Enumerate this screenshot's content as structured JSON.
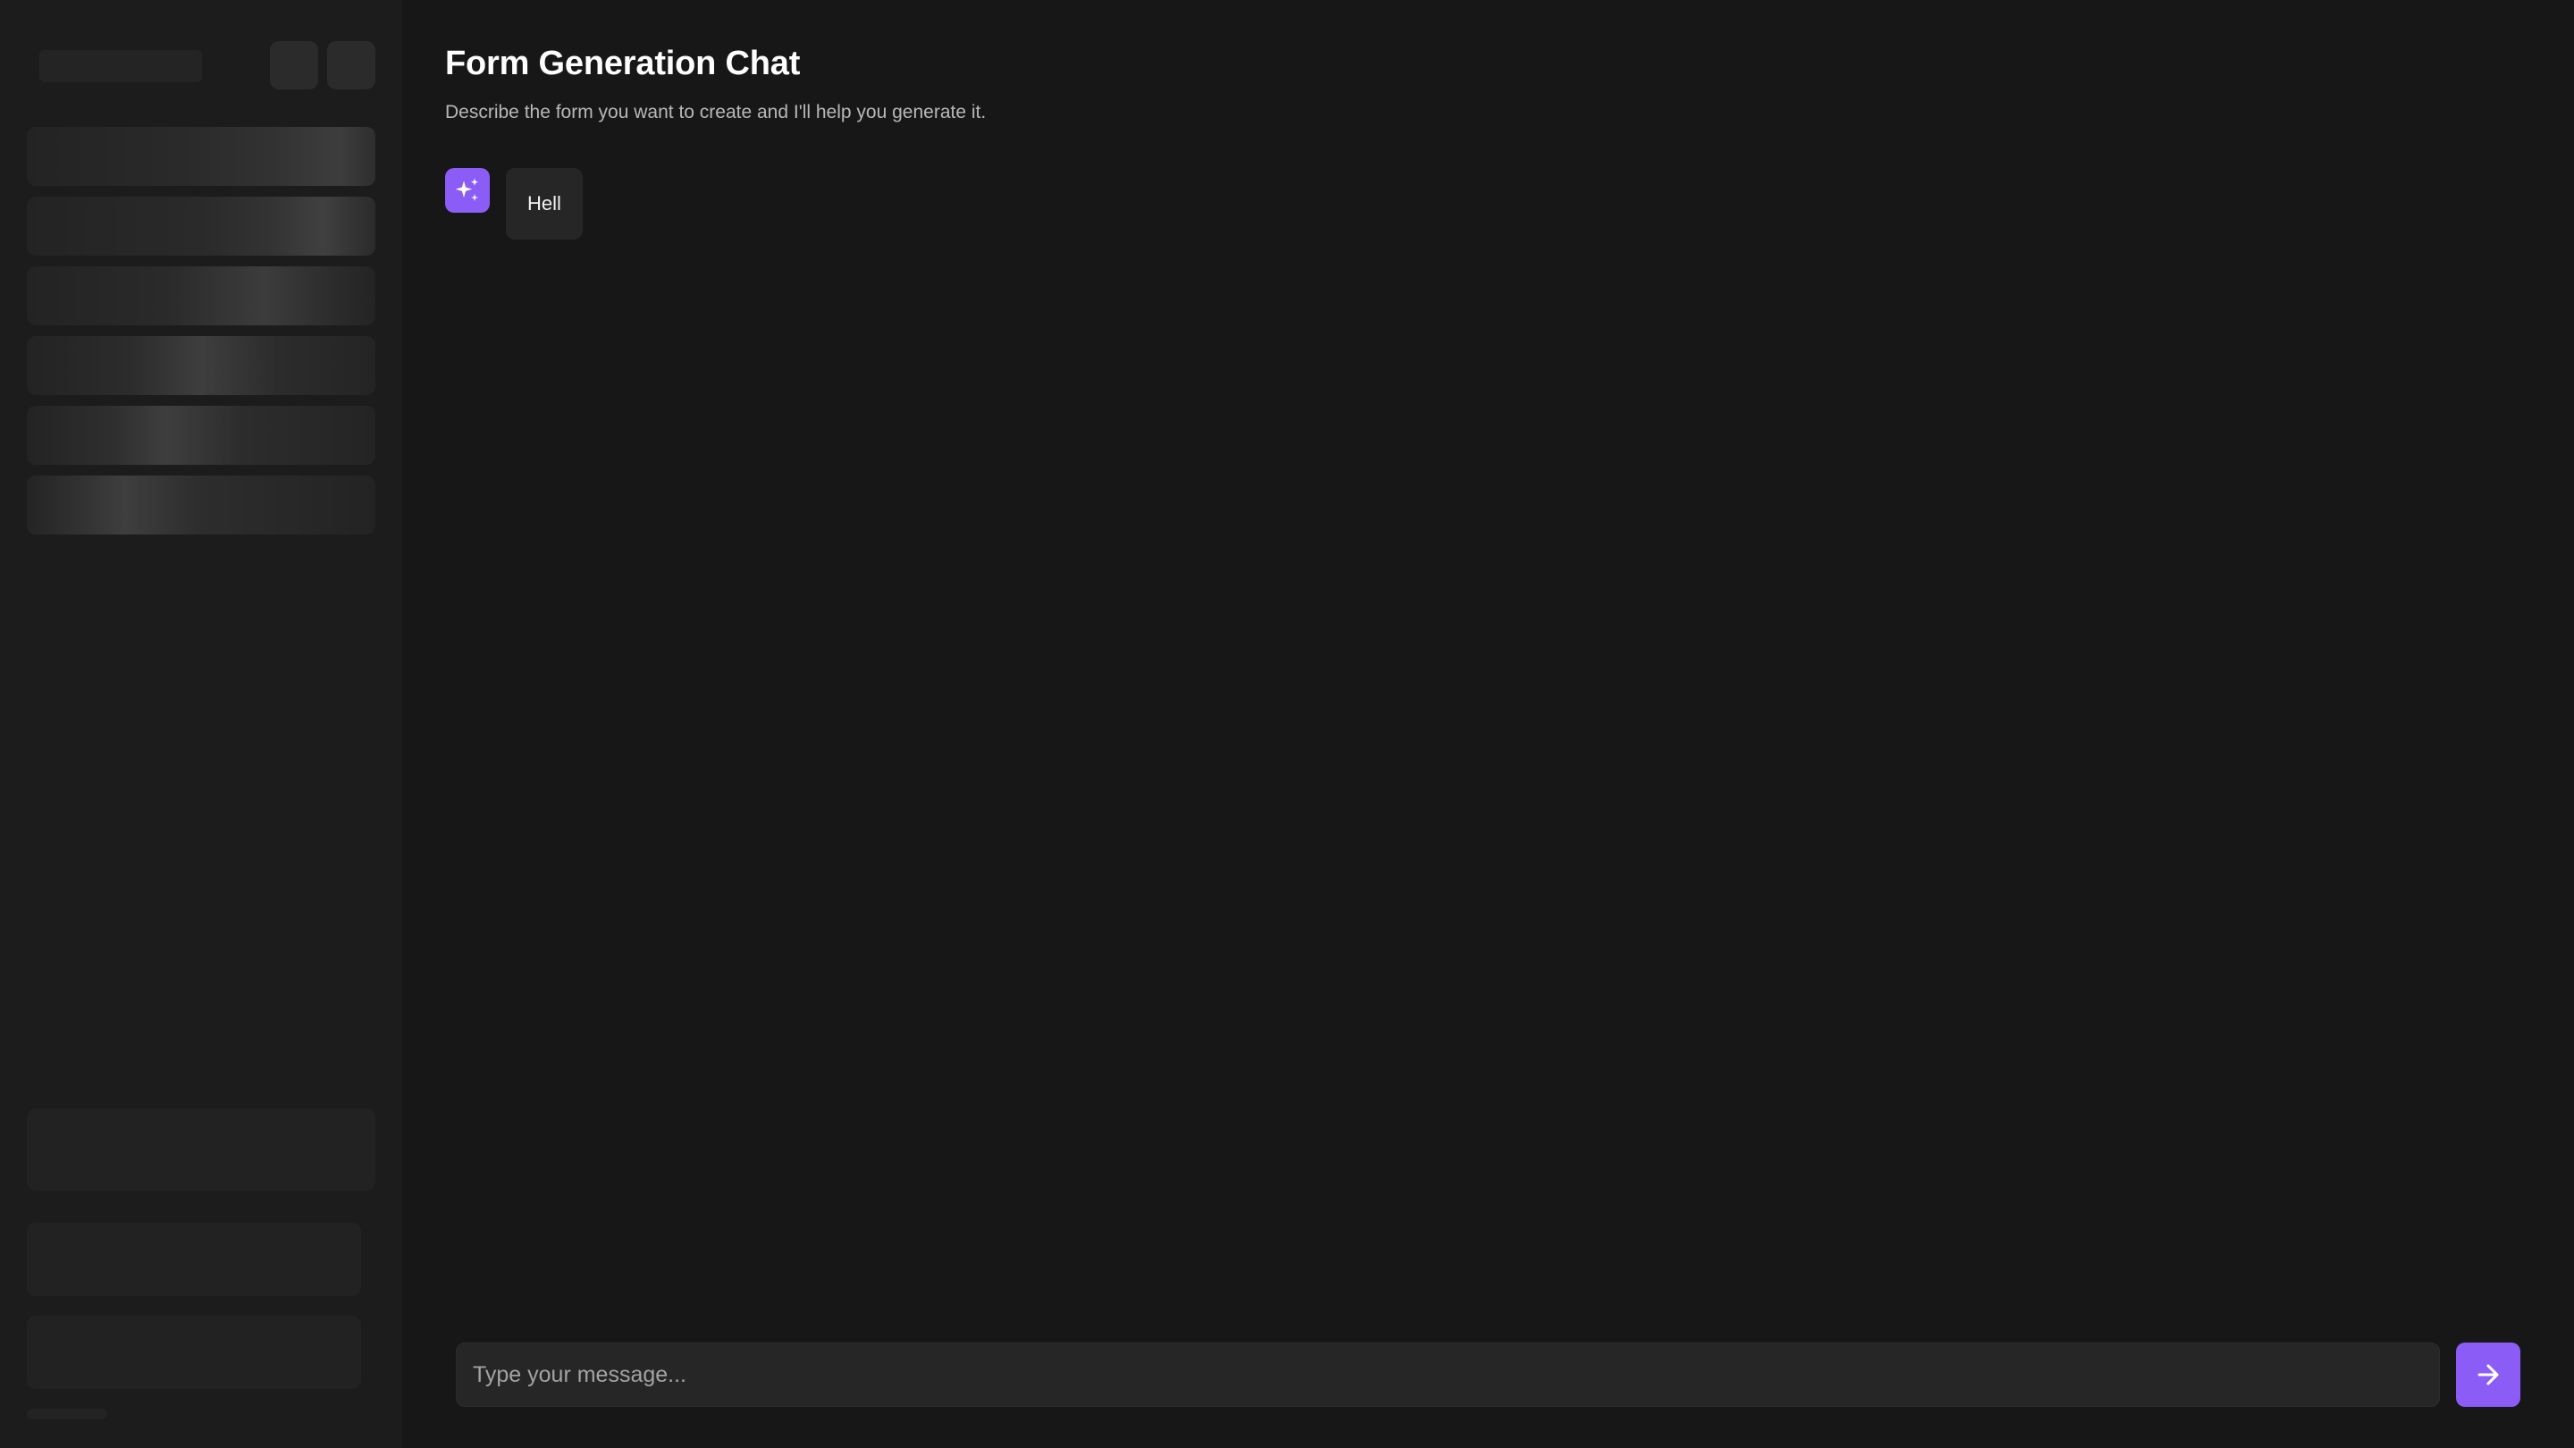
{
  "main": {
    "title": "Form Generation Chat",
    "subtitle": "Describe the form you want to create and I'll help you generate it.",
    "messages": [
      {
        "role": "assistant",
        "icon": "sparkles-icon",
        "text": "Hell"
      }
    ]
  },
  "composer": {
    "placeholder": "Type your message...",
    "value": "",
    "send_icon": "arrow-right-icon"
  },
  "sidebar": {
    "state": "loading",
    "skeleton_items": 6
  },
  "colors": {
    "background": "#171717",
    "sidebar": "#1c1c1c",
    "accent": "#8b5cf6",
    "bubble": "#262626",
    "subtitle_text": "#b8b8b8"
  }
}
